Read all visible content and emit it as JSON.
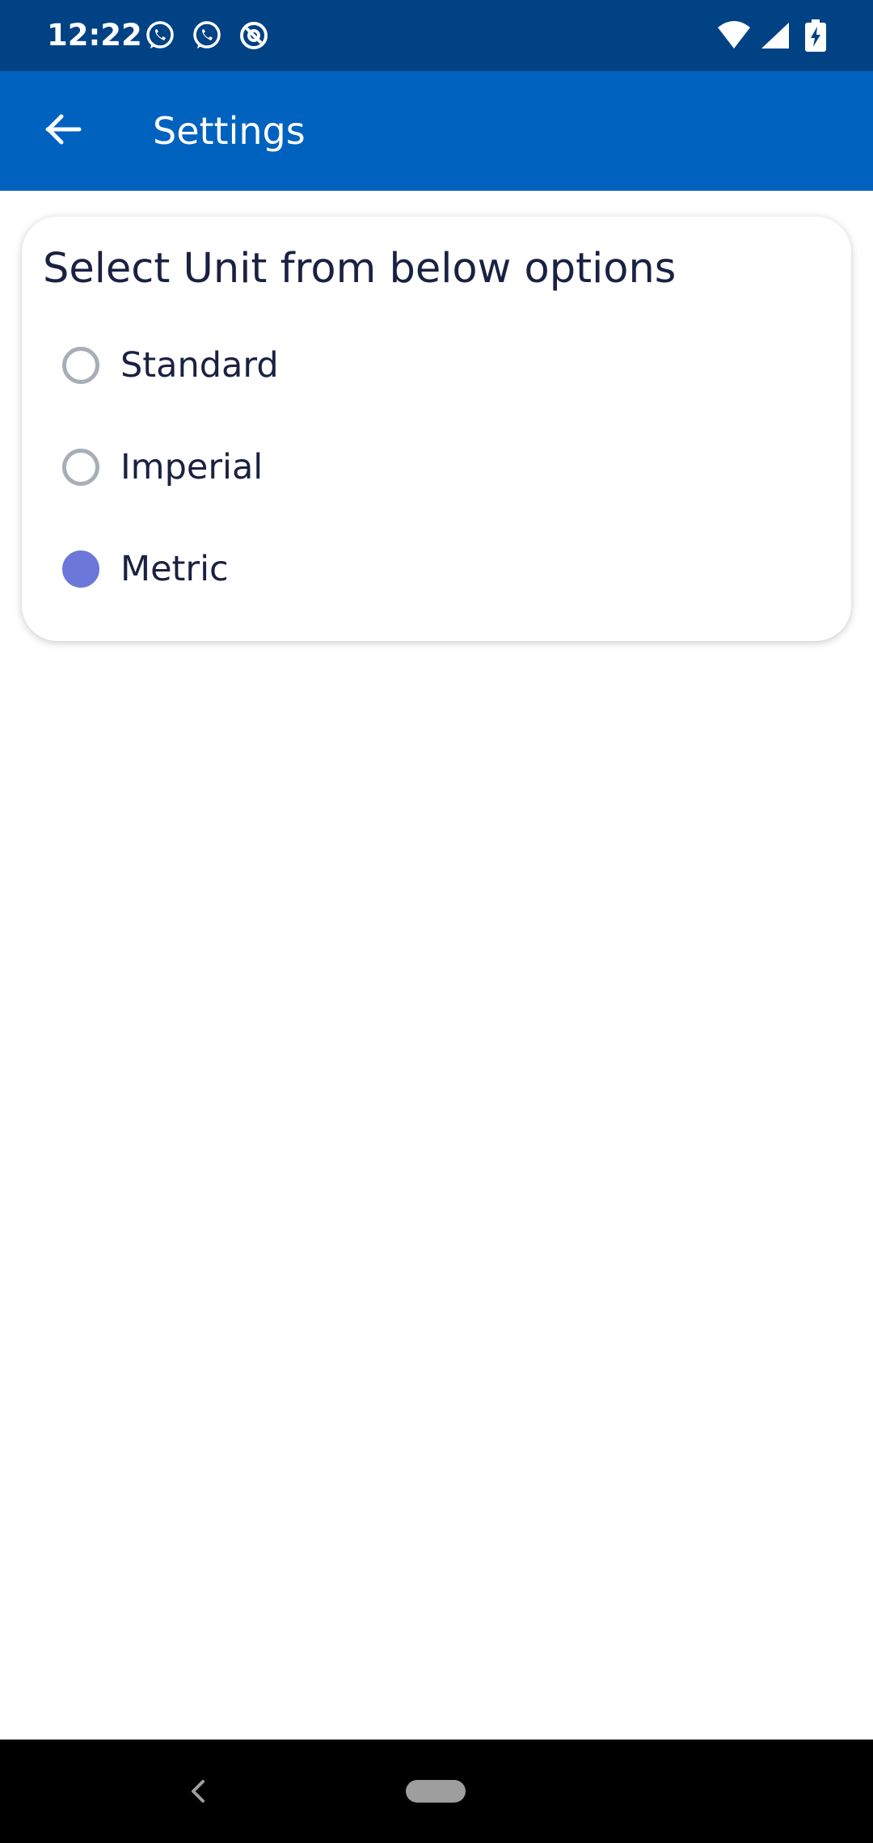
{
  "status_bar": {
    "time": "12:22",
    "icons": [
      "whatsapp-icon",
      "whatsapp-icon",
      "at-sign-icon",
      "wifi-icon",
      "signal-icon",
      "battery-charging-icon"
    ],
    "background_color": "#004284"
  },
  "app_bar": {
    "title": "Settings",
    "back_icon": "arrow-left-icon",
    "background_color": "#0062bf"
  },
  "unit_card": {
    "heading": "Select Unit from below options",
    "options": [
      {
        "label": "Standard",
        "selected": false
      },
      {
        "label": "Imperial",
        "selected": false
      },
      {
        "label": "Metric",
        "selected": true
      }
    ],
    "selected_color": "#6b78da"
  },
  "nav_bar": {
    "icons": [
      "nav-back-icon",
      "home-pill-icon"
    ]
  }
}
